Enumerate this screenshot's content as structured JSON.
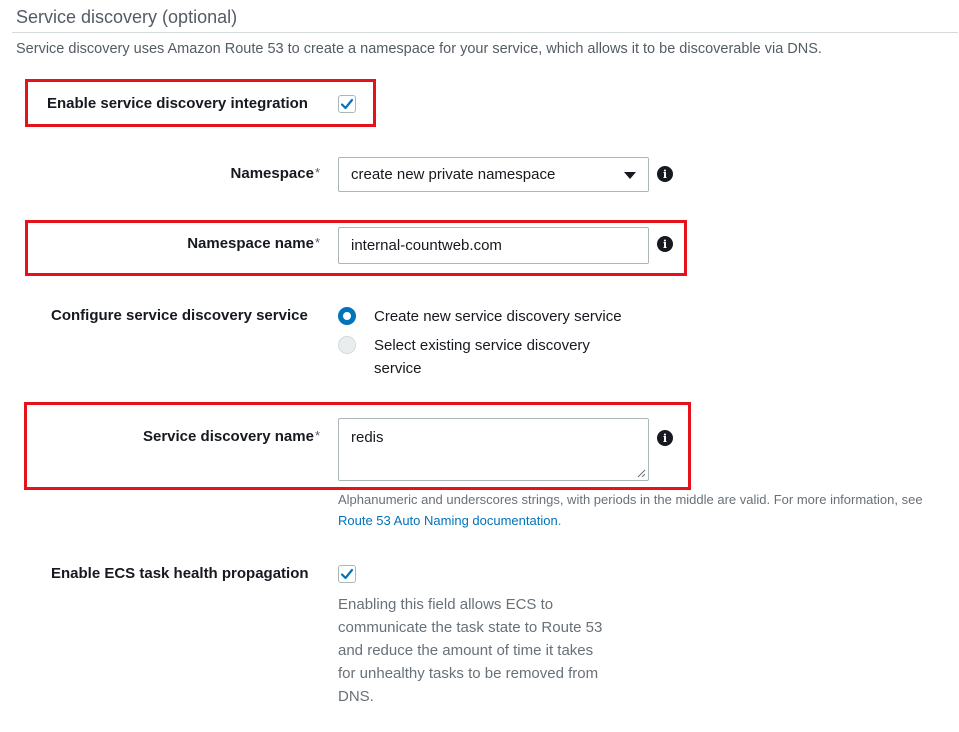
{
  "section": {
    "title": "Service discovery (optional)",
    "description": "Service discovery uses Amazon Route 53 to create a namespace for your service, which allows it to be discoverable via DNS."
  },
  "enable_integration": {
    "label": "Enable service discovery integration",
    "checked": true
  },
  "namespace": {
    "label": "Namespace",
    "required_mark": "*",
    "value": "create new private namespace"
  },
  "namespace_name": {
    "label": "Namespace name",
    "required_mark": "*",
    "value": "internal-countweb.com"
  },
  "configure_service": {
    "label": "Configure service discovery service",
    "options": [
      {
        "label": "Create new service discovery service",
        "selected": true
      },
      {
        "label_line1": "Select existing service discovery",
        "label_line2": "service",
        "selected": false
      }
    ]
  },
  "service_discovery_name": {
    "label": "Service discovery name",
    "required_mark": "*",
    "value": "redis",
    "help_text": "Alphanumeric and underscores strings, with periods in the middle are valid. For more information, see",
    "help_link": "Route 53 Auto Naming documentation",
    "help_suffix": "."
  },
  "health_propagation": {
    "label": "Enable ECS task health propagation",
    "checked": true,
    "description_lines": [
      "Enabling this field allows ECS to",
      "communicate the task state to Route 53",
      "and reduce the amount of time it takes",
      "for unhealthy tasks to be removed from",
      "DNS."
    ]
  },
  "colors": {
    "highlight": "#e3121b",
    "accent": "#0073bb"
  },
  "icons": {
    "info": "info-icon",
    "check": "check-icon",
    "caret": "caret-down-icon"
  }
}
